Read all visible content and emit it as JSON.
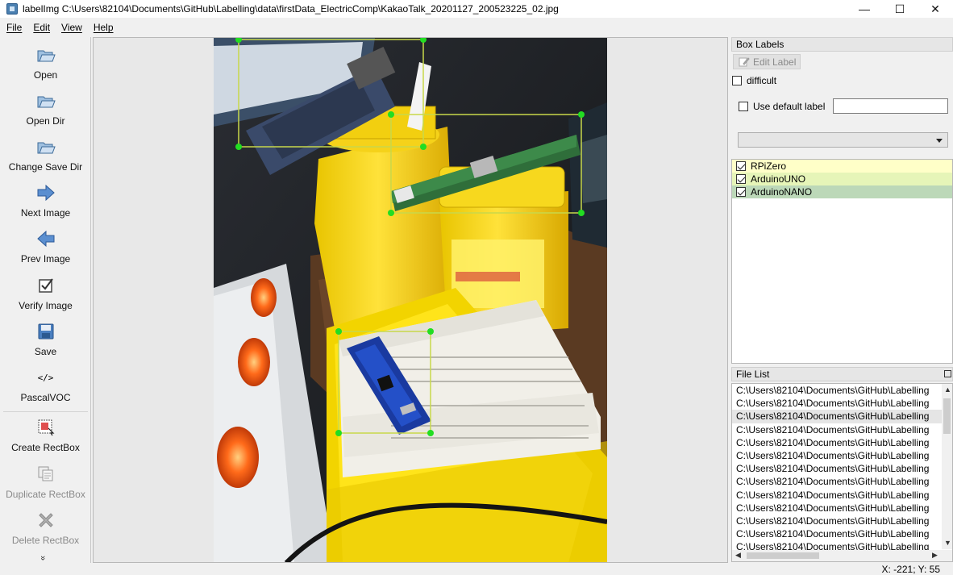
{
  "window": {
    "title": "labelImg C:\\Users\\82104\\Documents\\GitHub\\Labelling\\data\\firstData_ElectricComp\\KakaoTalk_20201127_200523225_02.jpg",
    "minimize": "—",
    "maximize": "☐",
    "close": "✕"
  },
  "menu": {
    "file": "File",
    "edit": "Edit",
    "view": "View",
    "help": "Help"
  },
  "toolbar": {
    "open": "Open",
    "open_dir": "Open Dir",
    "change_save_dir": "Change Save Dir",
    "next_image": "Next Image",
    "prev_image": "Prev Image",
    "verify_image": "Verify Image",
    "save": "Save",
    "format": "PascalVOC",
    "format_icon": "</>",
    "create_rectbox": "Create RectBox",
    "duplicate_rectbox": "Duplicate RectBox",
    "delete_rectbox": "Delete RectBox",
    "more": "»"
  },
  "box_labels": {
    "title": "Box Labels",
    "edit_label": "Edit Label",
    "difficult": "difficult",
    "use_default_label": "Use default label",
    "default_label_value": "",
    "combo_value": "",
    "labels": [
      {
        "name": "RPiZero",
        "checked": true,
        "color": "#ffffc8"
      },
      {
        "name": "ArduinoUNO",
        "checked": true,
        "color": "#e6f5b8"
      },
      {
        "name": "ArduinoNANO",
        "checked": true,
        "color": "#bcd8b8"
      }
    ]
  },
  "file_list": {
    "title": "File List",
    "items": [
      "C:\\Users\\82104\\Documents\\GitHub\\Labelling",
      "C:\\Users\\82104\\Documents\\GitHub\\Labelling",
      "C:\\Users\\82104\\Documents\\GitHub\\Labelling",
      "C:\\Users\\82104\\Documents\\GitHub\\Labelling",
      "C:\\Users\\82104\\Documents\\GitHub\\Labelling",
      "C:\\Users\\82104\\Documents\\GitHub\\Labelling",
      "C:\\Users\\82104\\Documents\\GitHub\\Labelling",
      "C:\\Users\\82104\\Documents\\GitHub\\Labelling",
      "C:\\Users\\82104\\Documents\\GitHub\\Labelling",
      "C:\\Users\\82104\\Documents\\GitHub\\Labelling",
      "C:\\Users\\82104\\Documents\\GitHub\\Labelling",
      "C:\\Users\\82104\\Documents\\GitHub\\Labelling",
      "C:\\Users\\82104\\Documents\\GitHub\\Labelling"
    ],
    "selected_index": 2
  },
  "status": {
    "coords": "X: -221; Y: 55"
  },
  "colors": {
    "box_line": "#c8d84a",
    "handle": "#22dd22",
    "accent_blue": "#4a84c8"
  }
}
